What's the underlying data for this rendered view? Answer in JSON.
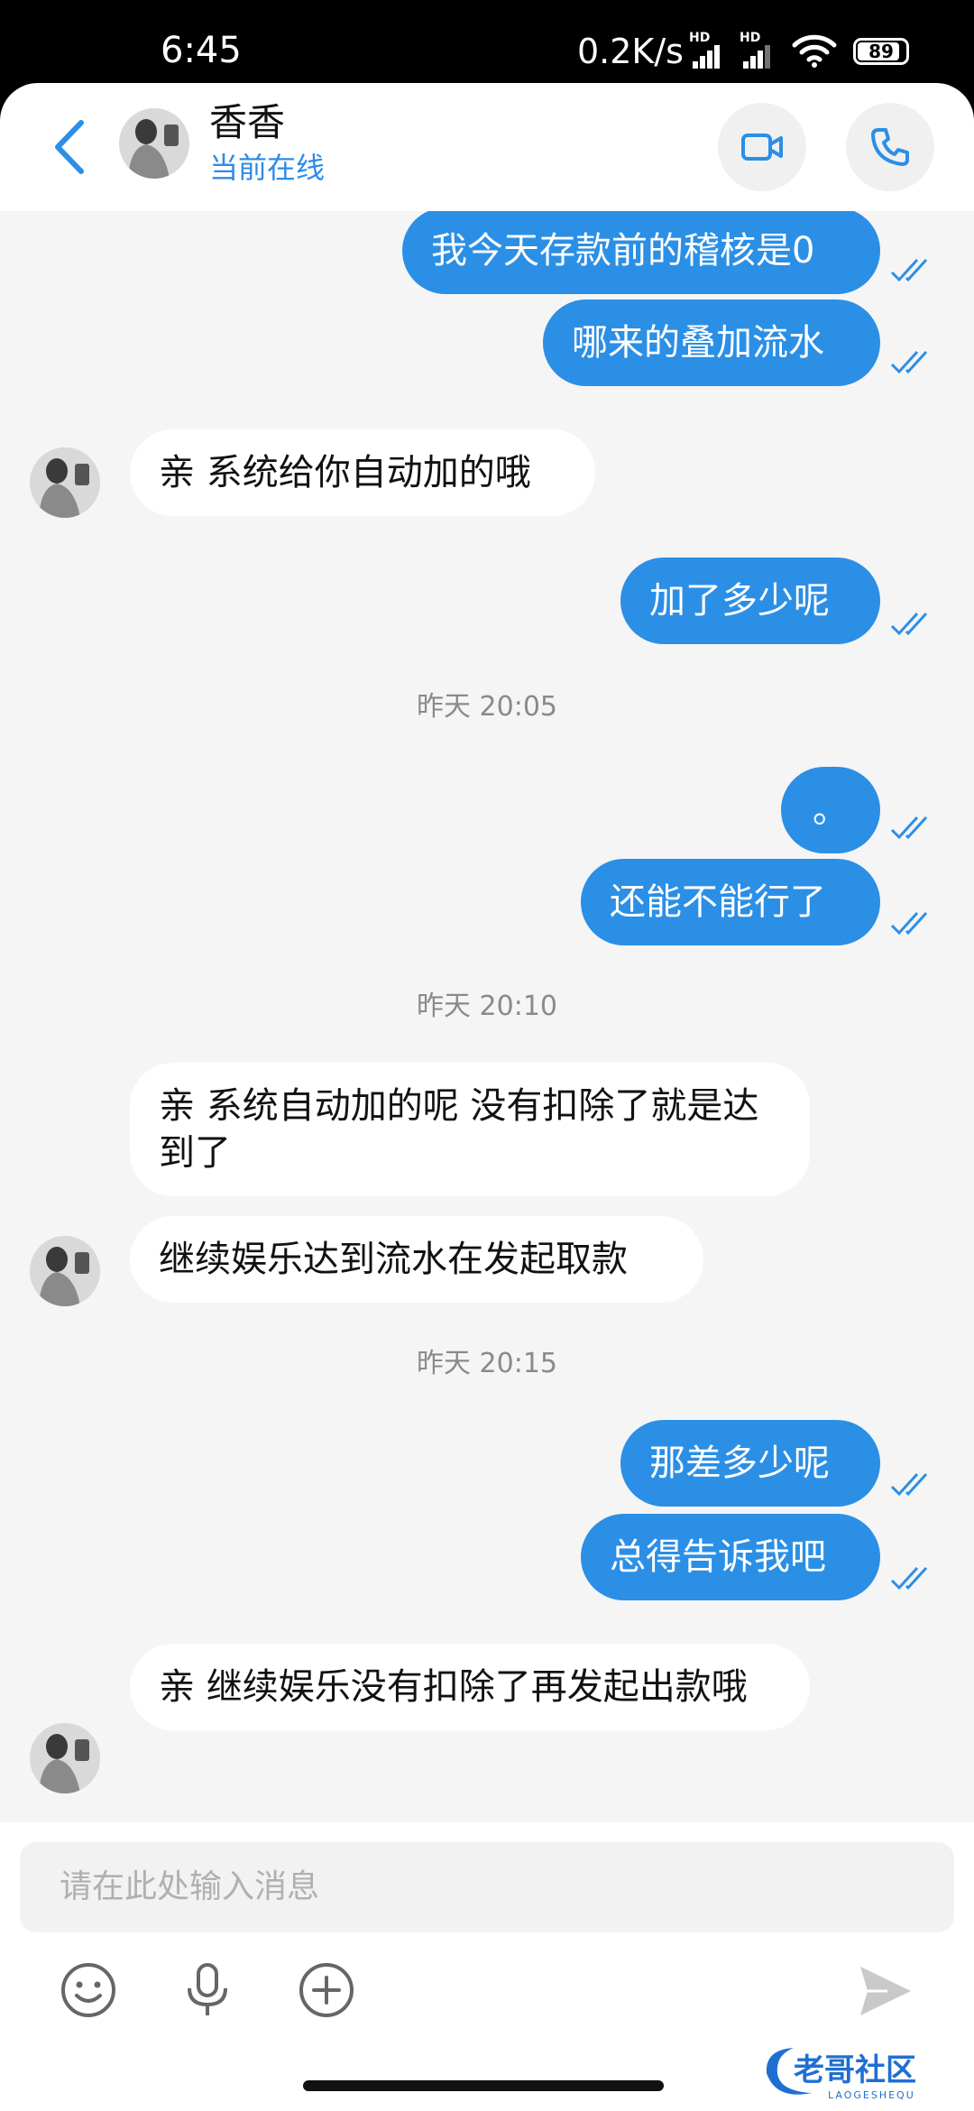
{
  "status_bar": {
    "time": "6:45",
    "net_speed": "0.2K/s",
    "sim1_tag": "HD",
    "sim2_tag": "HD",
    "battery": "89"
  },
  "header": {
    "back_icon": "chevron-left-icon",
    "contact_name": "香香",
    "contact_status": "当前在线",
    "video_icon": "video-camera-icon",
    "call_icon": "phone-icon",
    "accent_color": "#2b8fe6"
  },
  "chat": {
    "messages": [
      {
        "side": "out",
        "text": "我今天存款前的稽核是0",
        "read": true
      },
      {
        "side": "out",
        "text": "哪来的叠加流水",
        "read": true
      },
      {
        "side": "in",
        "text": "亲 系统给你自动加的哦"
      },
      {
        "side": "out",
        "text": "加了多少呢",
        "read": true
      },
      {
        "side": "time",
        "text": "昨天 20:05"
      },
      {
        "side": "out",
        "text": "。",
        "read": true
      },
      {
        "side": "out",
        "text": "还能不能行了",
        "read": true
      },
      {
        "side": "time",
        "text": "昨天 20:10"
      },
      {
        "side": "in",
        "text": "亲 系统自动加的呢 没有扣除了就是达到了"
      },
      {
        "side": "in",
        "text": "继续娱乐达到流水在发起取款"
      },
      {
        "side": "time",
        "text": "昨天 20:15"
      },
      {
        "side": "out",
        "text": "那差多少呢",
        "read": true
      },
      {
        "side": "out",
        "text": "总得告诉我吧",
        "read": true
      },
      {
        "side": "in",
        "text": "亲 继续娱乐没有扣除了再发起出款哦"
      }
    ]
  },
  "input": {
    "placeholder": "请在此处输入消息",
    "emoji_icon": "emoji-icon",
    "mic_icon": "microphone-icon",
    "plus_icon": "plus-circle-icon",
    "send_icon": "send-icon"
  },
  "watermark": {
    "text": "老哥社区",
    "subtext": "LAOGESHEQU"
  }
}
